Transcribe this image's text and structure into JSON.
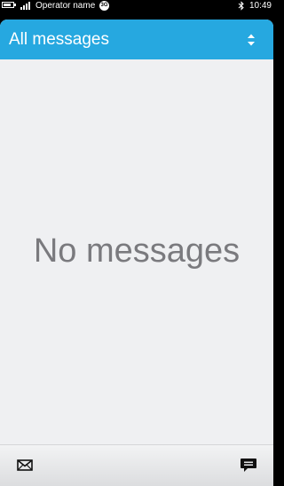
{
  "status_bar": {
    "operator": "Operator name",
    "network_badge": "3G",
    "time": "10:49"
  },
  "header": {
    "title": "All messages",
    "sort_icon": "sort-arrows-icon"
  },
  "main": {
    "empty_text": "No messages"
  },
  "toolbar": {
    "left_icon": "envelope-icon",
    "right_icon": "new-message-bubble-icon"
  },
  "colors": {
    "header": "#26a8e0",
    "background": "#eff0f2",
    "empty_text": "#7a7a7e"
  }
}
